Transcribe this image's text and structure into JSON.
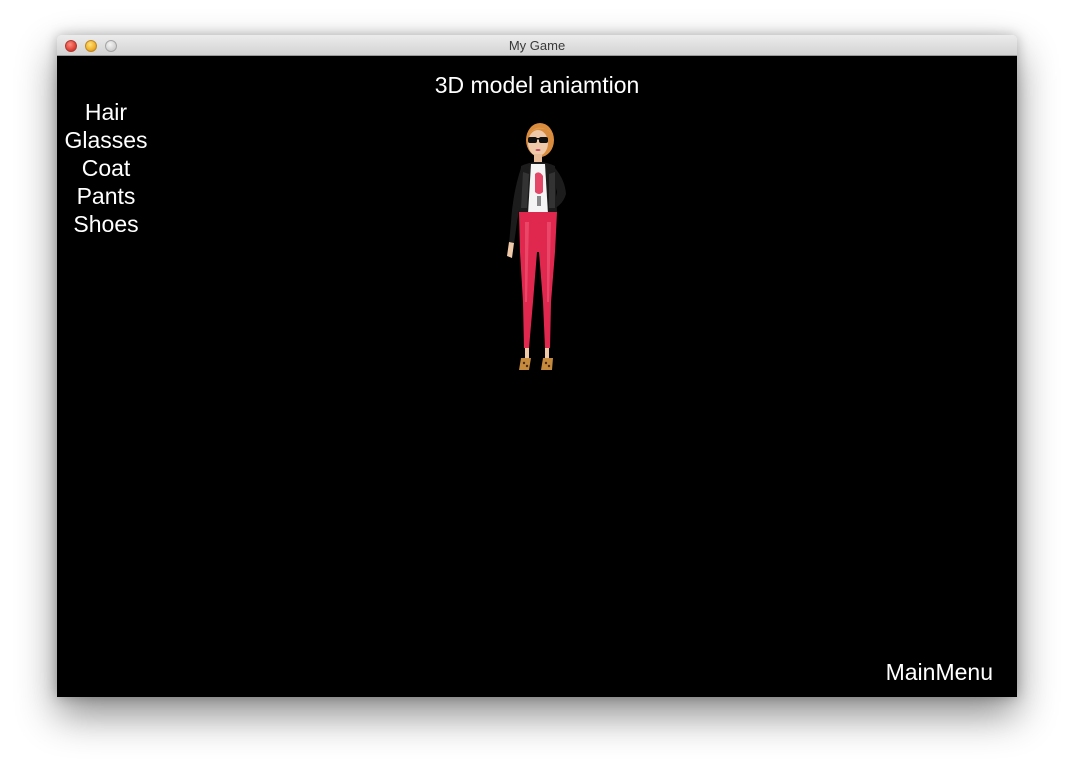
{
  "window": {
    "title": "My Game"
  },
  "scene": {
    "title": "3D model aniamtion",
    "character": "female 3d model with sunglasses, black leather jacket, red pants and leopard heels"
  },
  "wardrobe_menu": {
    "items": [
      {
        "label": "Hair"
      },
      {
        "label": "Glasses"
      },
      {
        "label": "Coat"
      },
      {
        "label": "Pants"
      },
      {
        "label": "Shoes"
      }
    ]
  },
  "footer": {
    "main_menu_label": "MainMenu"
  },
  "colors": {
    "background": "#000000",
    "text": "#ffffff",
    "pants": "#e0284f",
    "jacket": "#1c1c1c"
  }
}
